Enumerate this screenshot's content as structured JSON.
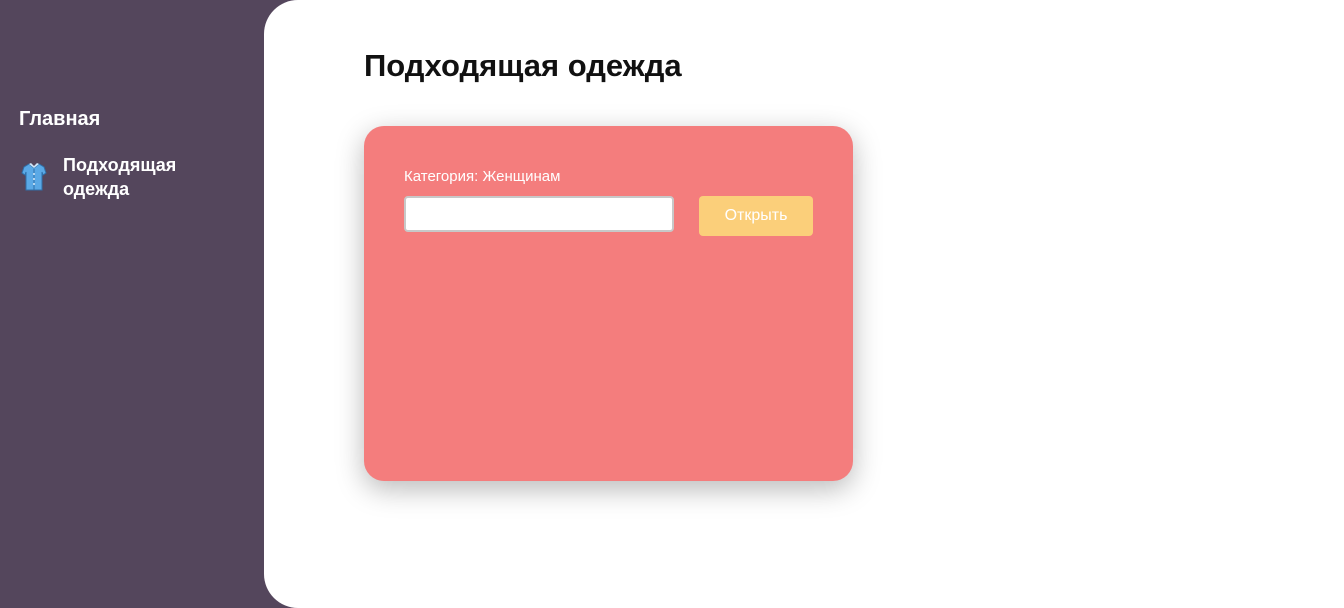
{
  "sidebar": {
    "heading": "Главная",
    "items": [
      {
        "label": "Подходящая одежда",
        "icon": "shirt-icon"
      }
    ]
  },
  "main": {
    "title": "Подходящая одежда",
    "card": {
      "category_label": "Категория: Женщинам",
      "input_value": "",
      "input_placeholder": "",
      "open_label": "Открыть"
    }
  },
  "colors": {
    "sidebar_bg": "#54465c",
    "main_bg": "#ffffff",
    "card_bg": "#f47d7d",
    "button_bg": "#fbcf7a",
    "text_light": "#ffffff"
  }
}
